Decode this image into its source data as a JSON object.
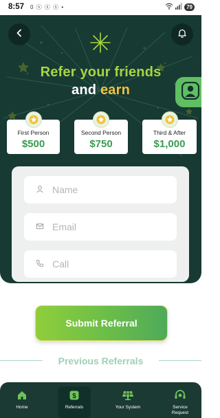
{
  "status_bar": {
    "time": "8:57",
    "icons_text": "0 ⓢ ⓢ ⓢ •",
    "battery": "79"
  },
  "header": {
    "back_icon": "back-arrow-icon",
    "bell_icon": "bell-icon",
    "title_line1": "Refer your friends",
    "title_line2_prefix": "and ",
    "title_line2_accent": "earn"
  },
  "rewards": [
    {
      "label": "First Person",
      "value": "$500"
    },
    {
      "label": "Second Person",
      "value": "$750"
    },
    {
      "label": "Third & After",
      "value": "$1,000"
    }
  ],
  "form": {
    "name_placeholder": "Name",
    "email_placeholder": "Email",
    "call_placeholder": "Call"
  },
  "submit_label": "Submit Referral",
  "previous_referrals_label": "Previous Referrals",
  "nav": [
    {
      "label": "Home",
      "icon": "home-icon"
    },
    {
      "label": "Referrals",
      "icon": "dollar-icon"
    },
    {
      "label": "Your System",
      "icon": "solar-panel-icon"
    },
    {
      "label": "Service\nRequest",
      "icon": "headset-icon"
    }
  ],
  "colors": {
    "hero_bg": "#173a33",
    "green_accent": "#a8d543",
    "yellow_accent": "#f2c23d",
    "value_green": "#3a9b4f",
    "nav_bg": "#1b3a34"
  }
}
